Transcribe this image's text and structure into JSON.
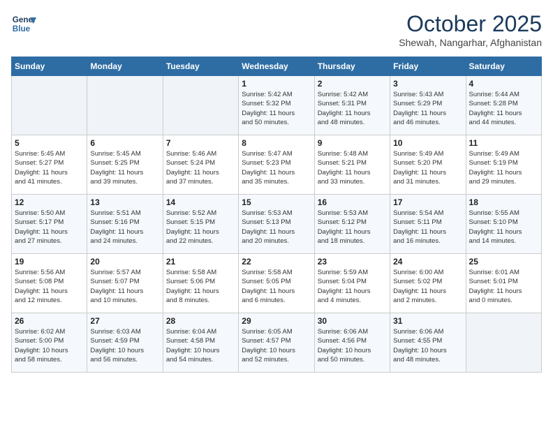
{
  "header": {
    "logo_line1": "General",
    "logo_line2": "Blue",
    "month": "October 2025",
    "location": "Shewah, Nangarhar, Afghanistan"
  },
  "weekdays": [
    "Sunday",
    "Monday",
    "Tuesday",
    "Wednesday",
    "Thursday",
    "Friday",
    "Saturday"
  ],
  "weeks": [
    [
      {
        "date": "",
        "info": ""
      },
      {
        "date": "",
        "info": ""
      },
      {
        "date": "",
        "info": ""
      },
      {
        "date": "1",
        "info": "Sunrise: 5:42 AM\nSunset: 5:32 PM\nDaylight: 11 hours\nand 50 minutes."
      },
      {
        "date": "2",
        "info": "Sunrise: 5:42 AM\nSunset: 5:31 PM\nDaylight: 11 hours\nand 48 minutes."
      },
      {
        "date": "3",
        "info": "Sunrise: 5:43 AM\nSunset: 5:29 PM\nDaylight: 11 hours\nand 46 minutes."
      },
      {
        "date": "4",
        "info": "Sunrise: 5:44 AM\nSunset: 5:28 PM\nDaylight: 11 hours\nand 44 minutes."
      }
    ],
    [
      {
        "date": "5",
        "info": "Sunrise: 5:45 AM\nSunset: 5:27 PM\nDaylight: 11 hours\nand 41 minutes."
      },
      {
        "date": "6",
        "info": "Sunrise: 5:45 AM\nSunset: 5:25 PM\nDaylight: 11 hours\nand 39 minutes."
      },
      {
        "date": "7",
        "info": "Sunrise: 5:46 AM\nSunset: 5:24 PM\nDaylight: 11 hours\nand 37 minutes."
      },
      {
        "date": "8",
        "info": "Sunrise: 5:47 AM\nSunset: 5:23 PM\nDaylight: 11 hours\nand 35 minutes."
      },
      {
        "date": "9",
        "info": "Sunrise: 5:48 AM\nSunset: 5:21 PM\nDaylight: 11 hours\nand 33 minutes."
      },
      {
        "date": "10",
        "info": "Sunrise: 5:49 AM\nSunset: 5:20 PM\nDaylight: 11 hours\nand 31 minutes."
      },
      {
        "date": "11",
        "info": "Sunrise: 5:49 AM\nSunset: 5:19 PM\nDaylight: 11 hours\nand 29 minutes."
      }
    ],
    [
      {
        "date": "12",
        "info": "Sunrise: 5:50 AM\nSunset: 5:17 PM\nDaylight: 11 hours\nand 27 minutes."
      },
      {
        "date": "13",
        "info": "Sunrise: 5:51 AM\nSunset: 5:16 PM\nDaylight: 11 hours\nand 24 minutes."
      },
      {
        "date": "14",
        "info": "Sunrise: 5:52 AM\nSunset: 5:15 PM\nDaylight: 11 hours\nand 22 minutes."
      },
      {
        "date": "15",
        "info": "Sunrise: 5:53 AM\nSunset: 5:13 PM\nDaylight: 11 hours\nand 20 minutes."
      },
      {
        "date": "16",
        "info": "Sunrise: 5:53 AM\nSunset: 5:12 PM\nDaylight: 11 hours\nand 18 minutes."
      },
      {
        "date": "17",
        "info": "Sunrise: 5:54 AM\nSunset: 5:11 PM\nDaylight: 11 hours\nand 16 minutes."
      },
      {
        "date": "18",
        "info": "Sunrise: 5:55 AM\nSunset: 5:10 PM\nDaylight: 11 hours\nand 14 minutes."
      }
    ],
    [
      {
        "date": "19",
        "info": "Sunrise: 5:56 AM\nSunset: 5:08 PM\nDaylight: 11 hours\nand 12 minutes."
      },
      {
        "date": "20",
        "info": "Sunrise: 5:57 AM\nSunset: 5:07 PM\nDaylight: 11 hours\nand 10 minutes."
      },
      {
        "date": "21",
        "info": "Sunrise: 5:58 AM\nSunset: 5:06 PM\nDaylight: 11 hours\nand 8 minutes."
      },
      {
        "date": "22",
        "info": "Sunrise: 5:58 AM\nSunset: 5:05 PM\nDaylight: 11 hours\nand 6 minutes."
      },
      {
        "date": "23",
        "info": "Sunrise: 5:59 AM\nSunset: 5:04 PM\nDaylight: 11 hours\nand 4 minutes."
      },
      {
        "date": "24",
        "info": "Sunrise: 6:00 AM\nSunset: 5:02 PM\nDaylight: 11 hours\nand 2 minutes."
      },
      {
        "date": "25",
        "info": "Sunrise: 6:01 AM\nSunset: 5:01 PM\nDaylight: 11 hours\nand 0 minutes."
      }
    ],
    [
      {
        "date": "26",
        "info": "Sunrise: 6:02 AM\nSunset: 5:00 PM\nDaylight: 10 hours\nand 58 minutes."
      },
      {
        "date": "27",
        "info": "Sunrise: 6:03 AM\nSunset: 4:59 PM\nDaylight: 10 hours\nand 56 minutes."
      },
      {
        "date": "28",
        "info": "Sunrise: 6:04 AM\nSunset: 4:58 PM\nDaylight: 10 hours\nand 54 minutes."
      },
      {
        "date": "29",
        "info": "Sunrise: 6:05 AM\nSunset: 4:57 PM\nDaylight: 10 hours\nand 52 minutes."
      },
      {
        "date": "30",
        "info": "Sunrise: 6:06 AM\nSunset: 4:56 PM\nDaylight: 10 hours\nand 50 minutes."
      },
      {
        "date": "31",
        "info": "Sunrise: 6:06 AM\nSunset: 4:55 PM\nDaylight: 10 hours\nand 48 minutes."
      },
      {
        "date": "",
        "info": ""
      }
    ]
  ]
}
